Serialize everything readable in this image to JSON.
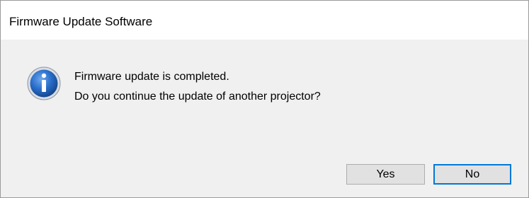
{
  "window": {
    "title": "Firmware Update Software"
  },
  "message": {
    "line1": "Firmware update is completed.",
    "line2": "Do you continue the update of another projector?"
  },
  "icon": {
    "name": "information-icon",
    "glyph": "i",
    "color": "#1f5fb8"
  },
  "buttons": {
    "yes_label": "Yes",
    "no_label": "No",
    "default": "No"
  },
  "colors": {
    "dialog_bg": "#f0f0f0",
    "focus_border": "#0078d7",
    "button_bg": "#e1e1e1"
  }
}
